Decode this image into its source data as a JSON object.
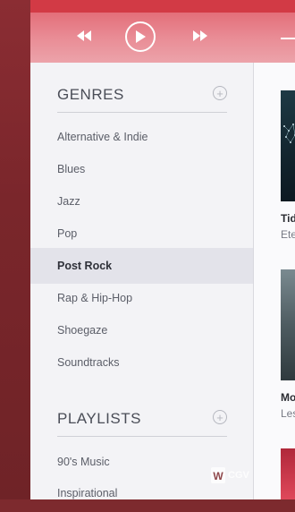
{
  "player": {
    "controls": [
      "rewind-icon",
      "play-icon",
      "fast-forward-icon"
    ]
  },
  "genres": {
    "title": "GENRES",
    "items": [
      {
        "label": "Alternative & Indie"
      },
      {
        "label": "Blues"
      },
      {
        "label": "Jazz"
      },
      {
        "label": "Pop"
      },
      {
        "label": "Post Rock",
        "active": true
      },
      {
        "label": "Rap & Hip-Hop"
      },
      {
        "label": "Shoegaze"
      },
      {
        "label": "Soundtracks"
      }
    ]
  },
  "playlists": {
    "title": "PLAYLISTS",
    "items": [
      {
        "label": "90's Music"
      },
      {
        "label": "Inspirational"
      }
    ]
  },
  "albums": [
    {
      "title": "Tid",
      "subtitle": "Ete"
    },
    {
      "title": "Mo",
      "subtitle": "Les"
    }
  ],
  "watermark": {
    "text": "CGV"
  },
  "colors": {
    "accent": "#d23a45",
    "sidebar_bg": "#f3f3f6",
    "active_bg": "#e3e3ea"
  }
}
